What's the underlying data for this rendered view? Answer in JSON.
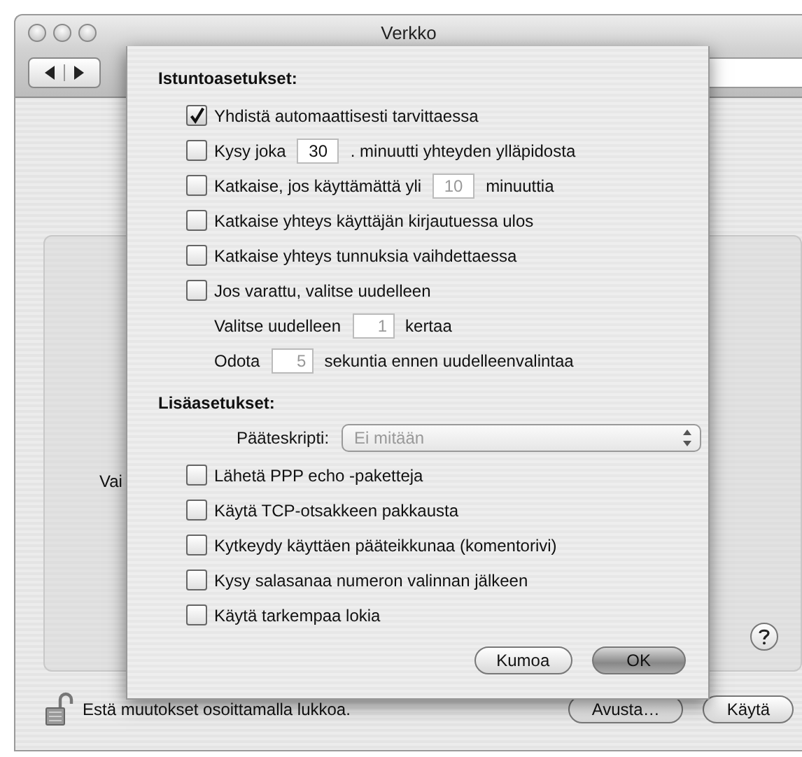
{
  "window": {
    "title": "Verkko",
    "partial_label": "Vai",
    "lock_text": "Estä muutokset osoittamalla lukkoa.",
    "buttons": [
      {
        "label": "Avusta…"
      },
      {
        "label": "Käytä"
      }
    ]
  },
  "sheet": {
    "session_heading": "Istuntoasetukset:",
    "session_options": [
      {
        "kind": "check",
        "label": "Yhdistä automaattisesti tarvittaessa",
        "checked": true
      },
      {
        "kind": "check_field",
        "label": "Kysy joka",
        "value": "30",
        "after": ". minuutti yhteyden ylläpidosta",
        "checked": false,
        "disabled": false
      },
      {
        "kind": "check_field",
        "label": "Katkaise, jos käyttämättä yli",
        "value": "10",
        "after": "minuuttia",
        "checked": false,
        "disabled": true
      },
      {
        "kind": "check",
        "label": "Katkaise yhteys käyttäjän kirjautuessa ulos",
        "checked": false
      },
      {
        "kind": "check",
        "label": "Katkaise yhteys tunnuksia vaihdettaessa",
        "checked": false
      },
      {
        "kind": "check",
        "label": "Jos varattu, valitse uudelleen",
        "checked": false
      },
      {
        "kind": "field",
        "label": "Valitse uudelleen",
        "value": "1",
        "after": "kertaa",
        "disabled": true
      },
      {
        "kind": "field",
        "label": "Odota",
        "value": "5",
        "after": "sekuntia ennen uudelleenvalintaa",
        "disabled": true
      }
    ],
    "advanced_heading": "Lisäasetukset:",
    "script": {
      "label": "Pääteskripti:",
      "value": "Ei mitään",
      "disabled": true
    },
    "advanced_options": [
      {
        "label": "Lähetä PPP echo -paketteja",
        "checked": false
      },
      {
        "label": "Käytä TCP-otsakkeen pakkausta",
        "checked": false
      },
      {
        "label": "Kytkeydy käyttäen pääteikkunaa (komentorivi)",
        "checked": false
      },
      {
        "label": "Kysy salasanaa numeron valinnan jälkeen",
        "checked": false
      },
      {
        "label": "Käytä tarkempaa lokia",
        "checked": false
      }
    ],
    "buttons": [
      {
        "label": "Kumoa",
        "default": false
      },
      {
        "label": "OK",
        "default": true
      }
    ]
  }
}
